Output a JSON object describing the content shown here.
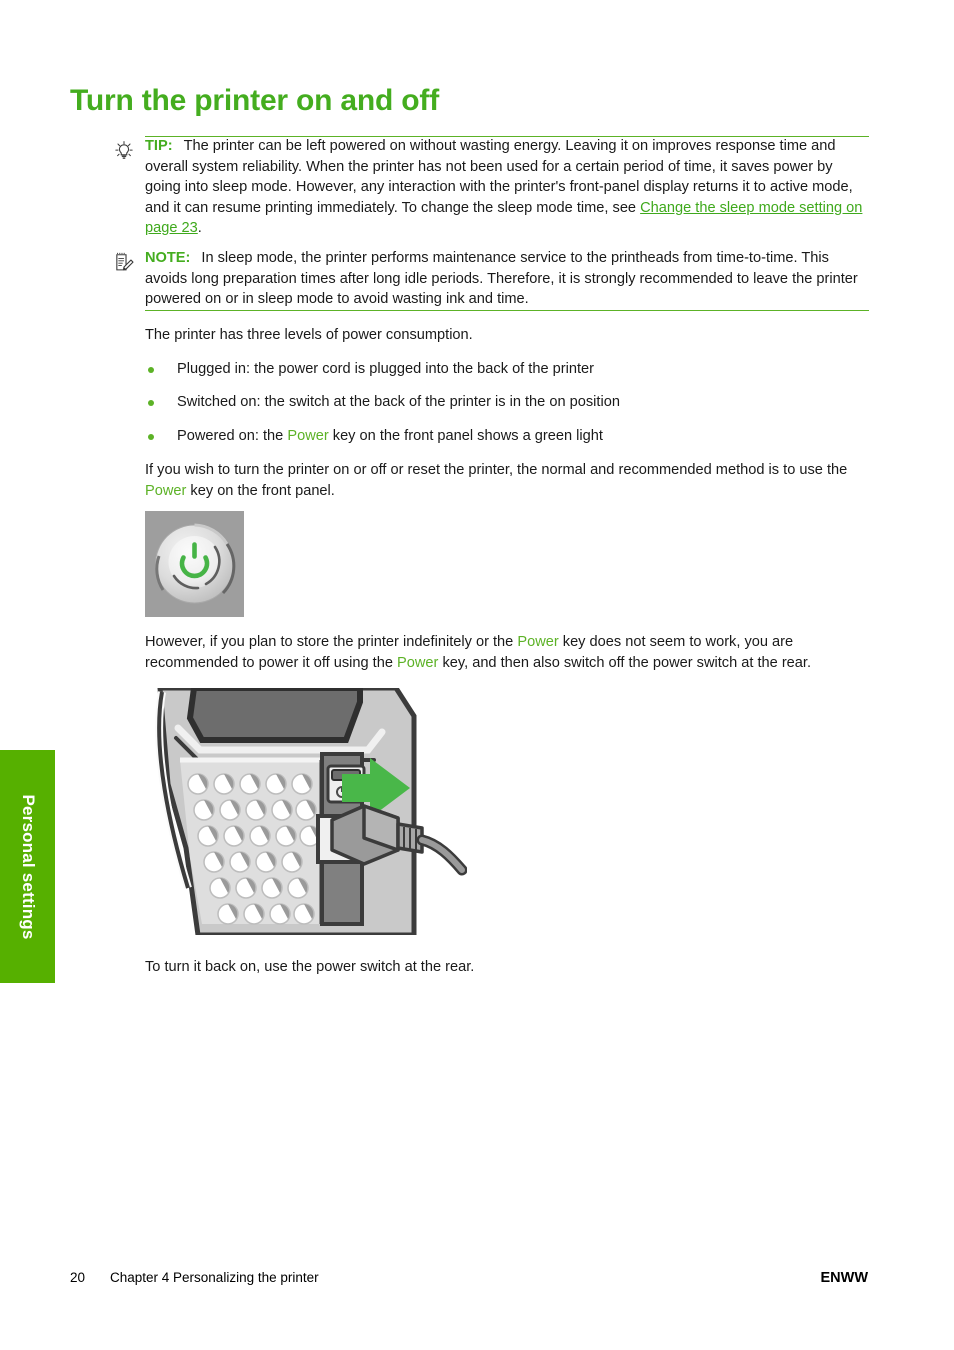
{
  "side_tab": {
    "label": "Personal settings",
    "color": "#56b000"
  },
  "page_title": "Turn the printer on and off",
  "colors": {
    "heading_green": "#44ad1f",
    "accent_green": "#5cb226",
    "link_green": "#3fa91c",
    "tab_green": "#56b000"
  },
  "tip": {
    "icon": "lightbulb-icon",
    "label": "TIP:",
    "text_before_link": "The printer can be left powered on without wasting energy. Leaving it on improves response time and overall system reliability. When the printer has not been used for a certain period of time, it saves power by going into sleep mode. However, any interaction with the printer's front-panel display returns it to active mode, and it can resume printing immediately. To change the sleep mode time, see ",
    "link_text": "Change the sleep mode setting on page 23",
    "text_after_link": "."
  },
  "note": {
    "icon": "notepad-pencil-icon",
    "label": "NOTE:",
    "text": "In sleep mode, the printer performs maintenance service to the printheads from time-to-time. This avoids long preparation times after long idle periods. Therefore, it is strongly recommended to leave the printer powered on or in sleep mode to avoid wasting ink and time."
  },
  "intro_paragraph": "The printer has three levels of power consumption.",
  "bullets": [
    {
      "before": "Plugged in: the power cord is plugged into the back of the printer",
      "highlight": "",
      "after": ""
    },
    {
      "before": "Switched on: the switch at the back of the printer is in the on position",
      "highlight": "",
      "after": ""
    },
    {
      "before": "Powered on: the ",
      "highlight": "Power",
      "after": " key on the front panel shows a green light"
    }
  ],
  "paragraph_power_key": {
    "part1": "If you wish to turn the printer on or off or reset the printer, the normal and recommended method is to use the ",
    "highlight": "Power",
    "part2": " key on the front panel."
  },
  "figure_power_button": {
    "name": "front-panel-power-key-illustration",
    "symbol": "power-symbol-icon"
  },
  "paragraph_store": {
    "part1": "However, if you plan to store the printer indefinitely or the ",
    "highlight1": "Power",
    "part2": " key does not seem to work, you are recommended to power it off using the ",
    "highlight2": "Power",
    "part3": " key, and then also switch off the power switch at the rear."
  },
  "figure_rear": {
    "name": "printer-rear-power-switch-illustration",
    "callout": "green-arrow-icon"
  },
  "closing_paragraph": "To turn it back on, use the power switch at the rear.",
  "footer": {
    "page_number": "20",
    "chapter": "Chapter 4   Personalizing the printer",
    "right": "ENWW"
  }
}
